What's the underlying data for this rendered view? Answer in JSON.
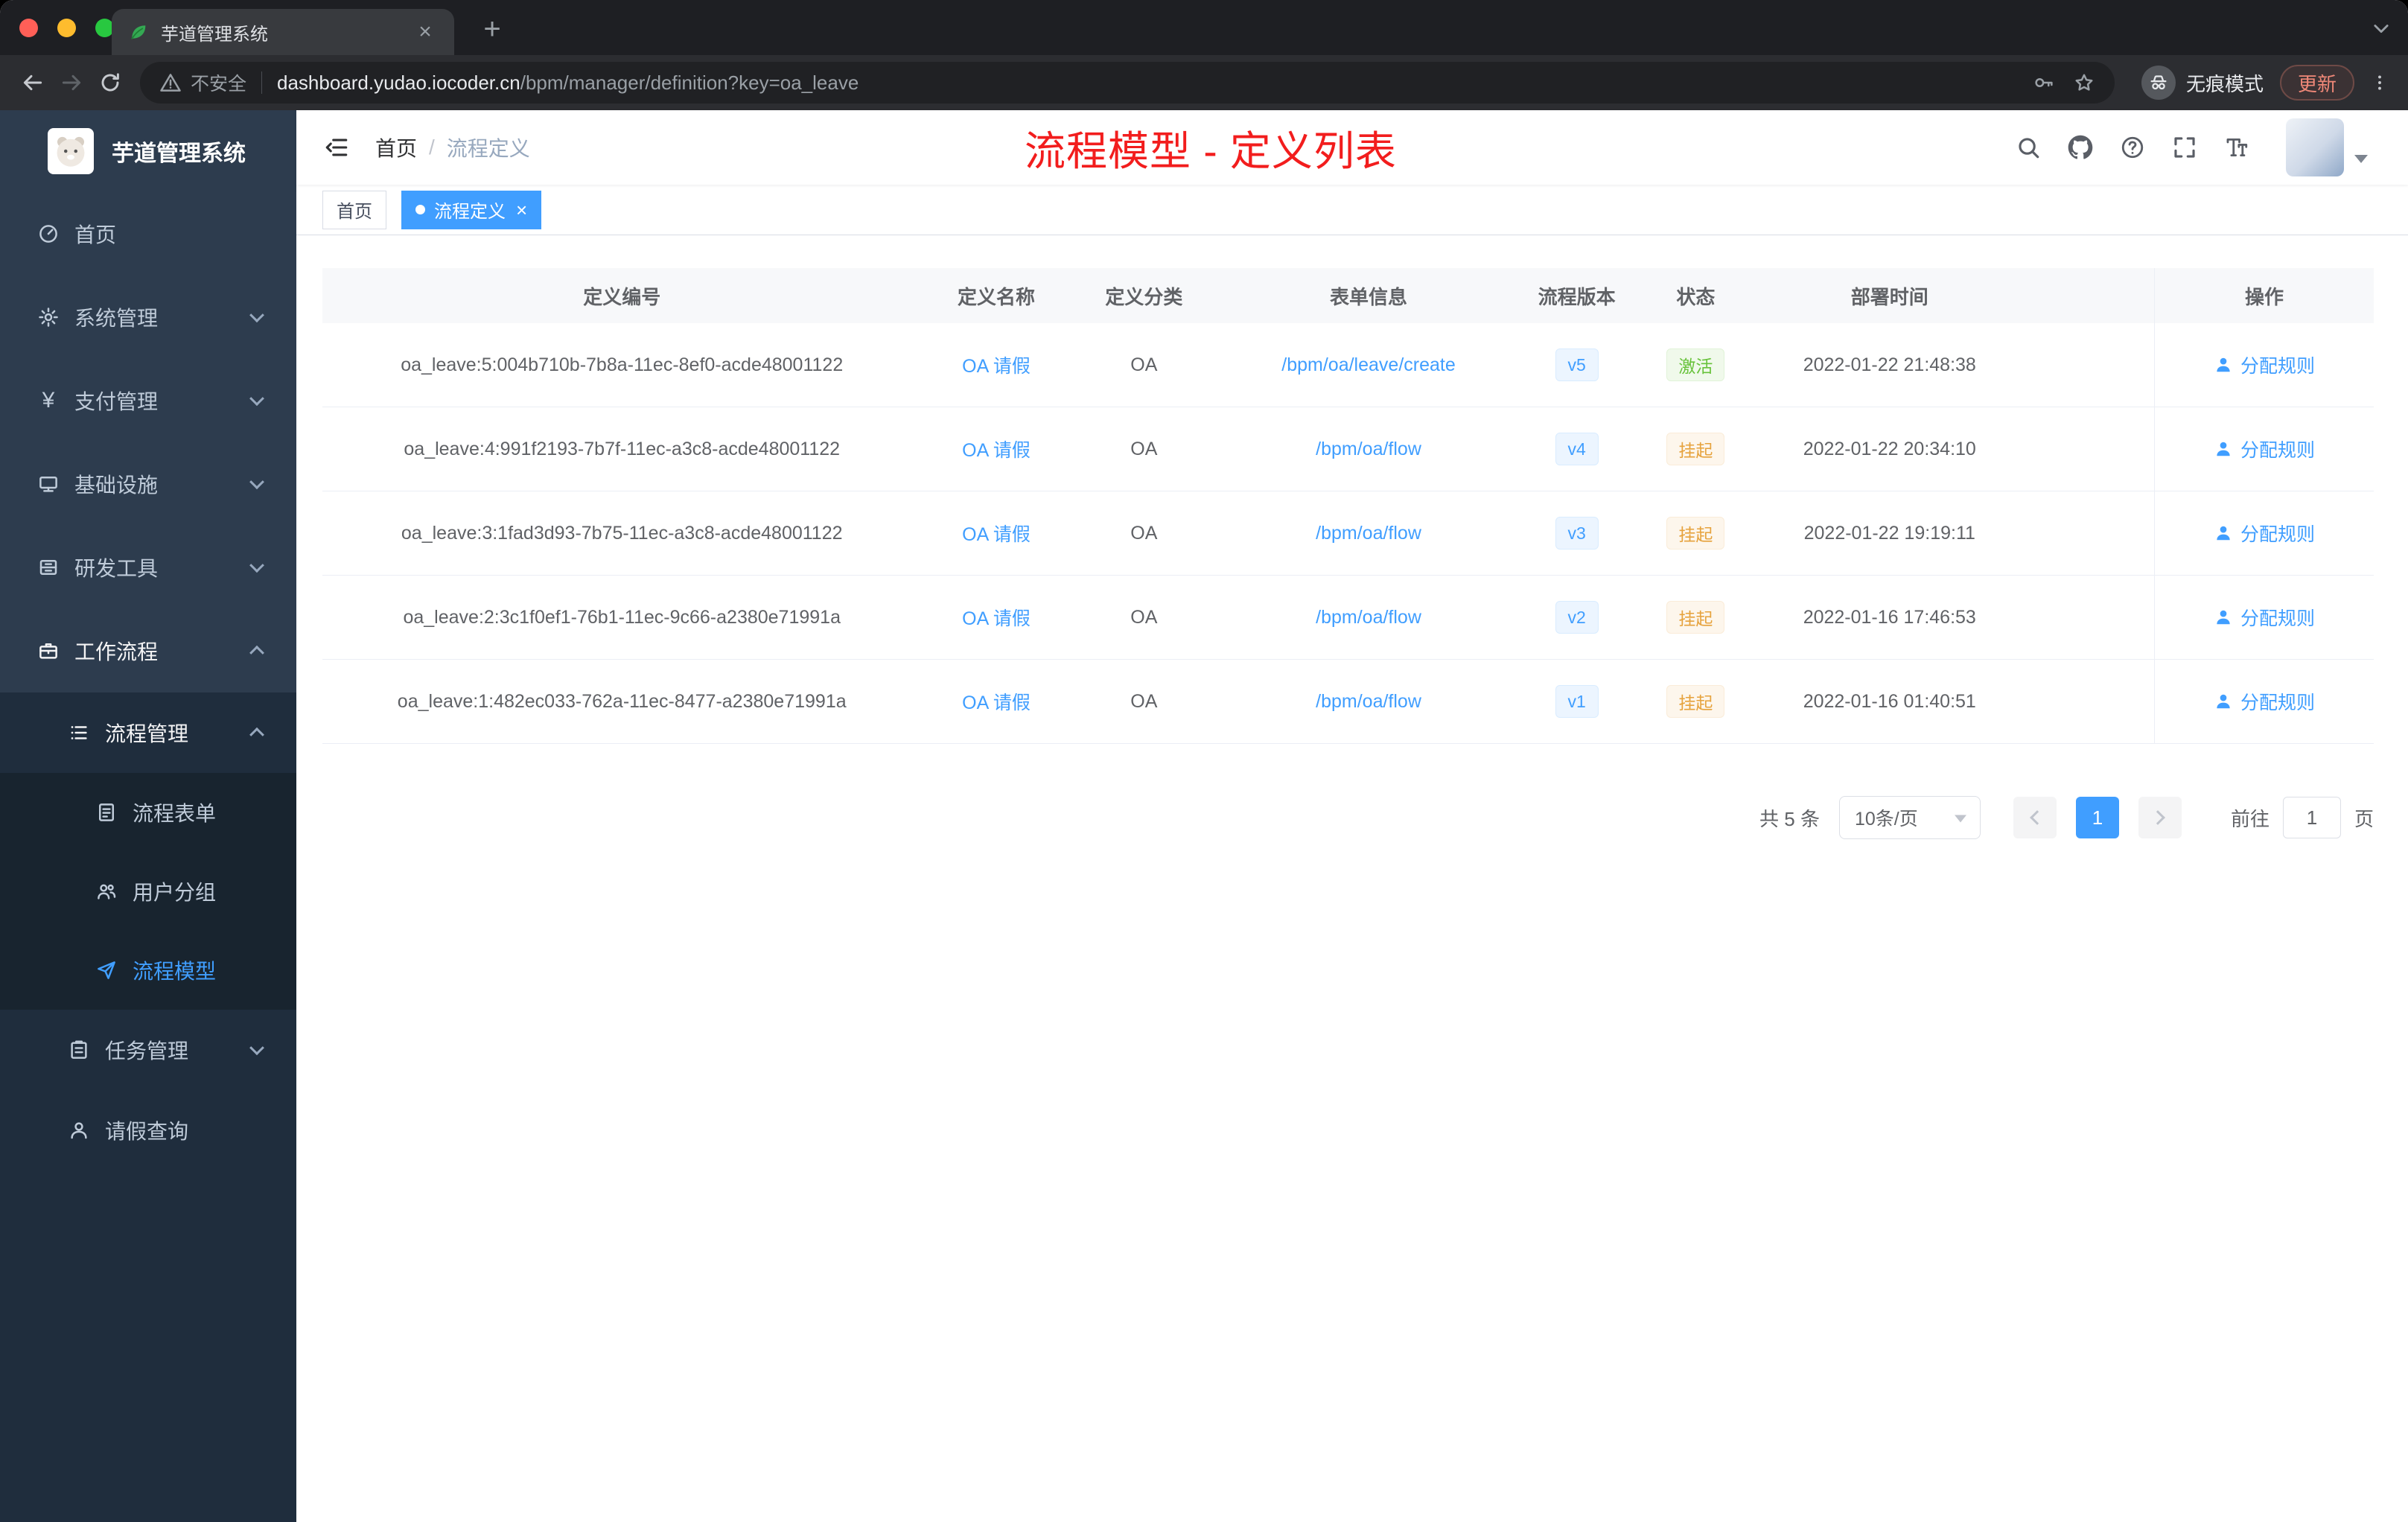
{
  "colors": {
    "accent": "#409eff",
    "success": "#67c23a",
    "warning": "#e6a23c",
    "annotation_red": "#f21d1d",
    "sidebar_bg": "#2d3c4e",
    "submenu_bg": "#1f2d3d"
  },
  "browser": {
    "tab_title": "芋道管理系统",
    "security_label": "不安全",
    "url_host": "dashboard.yudao.iocoder.cn",
    "url_path": "/bpm/manager/definition?key=oa_leave",
    "incognito_label": "无痕模式",
    "update_label": "更新"
  },
  "sidebar": {
    "logo_title": "芋道管理系统",
    "items": [
      {
        "label": "首页",
        "icon": "dashboard-icon"
      },
      {
        "label": "系统管理",
        "icon": "gear-icon"
      },
      {
        "label": "支付管理",
        "icon": "payment-icon"
      },
      {
        "label": "基础设施",
        "icon": "infrastructure-icon"
      },
      {
        "label": "研发工具",
        "icon": "devtools-icon"
      },
      {
        "label": "工作流程",
        "icon": "workflow-icon"
      }
    ],
    "workflow_children": {
      "process_mgmt": {
        "label": "流程管理",
        "icon": "process-list-icon"
      },
      "process_children": [
        {
          "label": "流程表单",
          "icon": "form-icon"
        },
        {
          "label": "用户分组",
          "icon": "user-group-icon"
        },
        {
          "label": "流程模型",
          "icon": "paper-plane-icon"
        }
      ],
      "task_mgmt": {
        "label": "任务管理",
        "icon": "task-icon"
      },
      "leave_query": {
        "label": "请假查询",
        "icon": "person-icon"
      }
    }
  },
  "navbar": {
    "breadcrumb": [
      "首页",
      "流程定义"
    ],
    "annotation": "流程模型 - 定义列表"
  },
  "tags": {
    "home": "首页",
    "active": "流程定义"
  },
  "table": {
    "columns": [
      "定义编号",
      "定义名称",
      "定义分类",
      "表单信息",
      "流程版本",
      "状态",
      "部署时间",
      "操作"
    ],
    "rows": [
      {
        "id": "oa_leave:5:004b710b-7b8a-11ec-8ef0-acde48001122",
        "name": "OA 请假",
        "category": "OA",
        "form": "/bpm/oa/leave/create",
        "version": "v5",
        "status": "激活",
        "status_type": "success",
        "deploy_time": "2022-01-22 21:48:38",
        "action": "分配规则"
      },
      {
        "id": "oa_leave:4:991f2193-7b7f-11ec-a3c8-acde48001122",
        "name": "OA 请假",
        "category": "OA",
        "form": "/bpm/oa/flow",
        "version": "v4",
        "status": "挂起",
        "status_type": "warning",
        "deploy_time": "2022-01-22 20:34:10",
        "action": "分配规则"
      },
      {
        "id": "oa_leave:3:1fad3d93-7b75-11ec-a3c8-acde48001122",
        "name": "OA 请假",
        "category": "OA",
        "form": "/bpm/oa/flow",
        "version": "v3",
        "status": "挂起",
        "status_type": "warning",
        "deploy_time": "2022-01-22 19:19:11",
        "action": "分配规则"
      },
      {
        "id": "oa_leave:2:3c1f0ef1-76b1-11ec-9c66-a2380e71991a",
        "name": "OA 请假",
        "category": "OA",
        "form": "/bpm/oa/flow",
        "version": "v2",
        "status": "挂起",
        "status_type": "warning",
        "deploy_time": "2022-01-16 17:46:53",
        "action": "分配规则"
      },
      {
        "id": "oa_leave:1:482ec033-762a-11ec-8477-a2380e71991a",
        "name": "OA 请假",
        "category": "OA",
        "form": "/bpm/oa/flow",
        "version": "v1",
        "status": "挂起",
        "status_type": "warning",
        "deploy_time": "2022-01-16 01:40:51",
        "action": "分配规则"
      }
    ]
  },
  "pagination": {
    "total": "共 5 条",
    "page_size": "10条/页",
    "current_page": "1",
    "goto_label": "前往",
    "goto_value": "1",
    "page_unit": "页"
  }
}
